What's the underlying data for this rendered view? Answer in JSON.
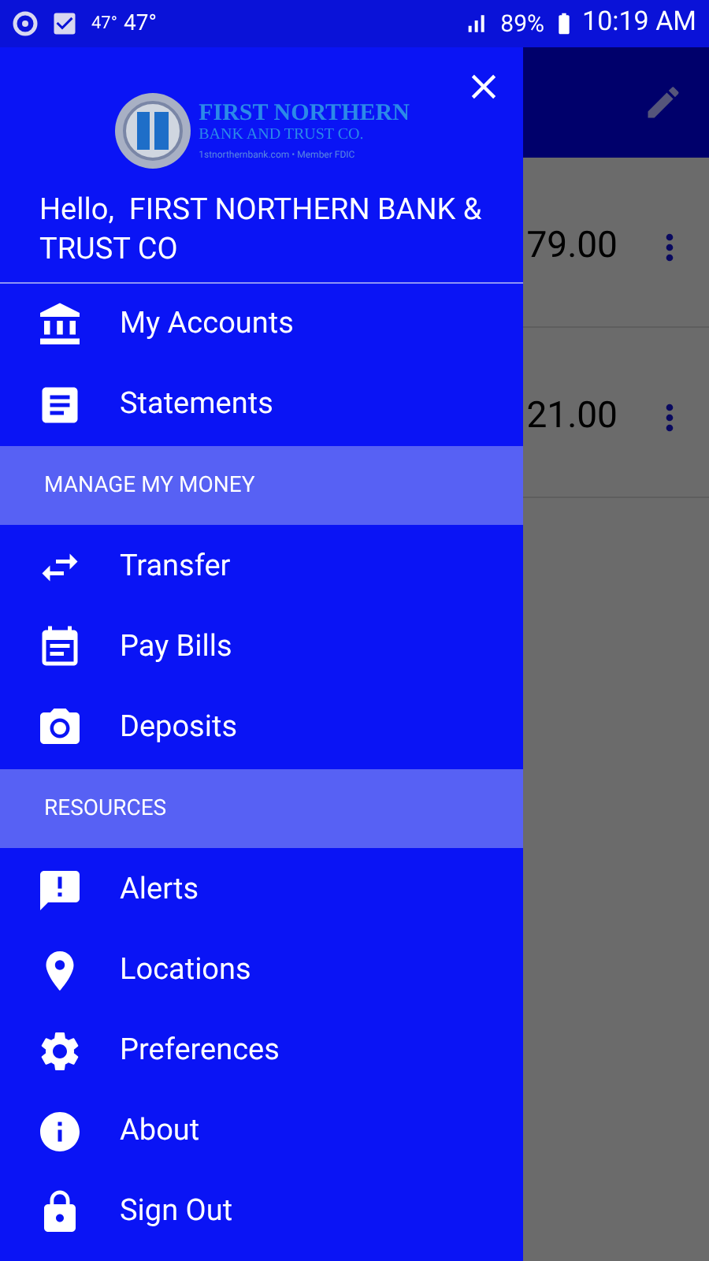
{
  "status_bar": {
    "temp_small": "47°",
    "temp": "47°",
    "battery": "89%",
    "time": "10:19 AM"
  },
  "background": {
    "rows": [
      {
        "amount": "79.00"
      },
      {
        "amount": "21.00"
      }
    ]
  },
  "drawer": {
    "logo": {
      "name": "FIRST NORTHERN",
      "subtitle": "BANK AND TRUST CO.",
      "tagline": "1stnorthernbank.com • Member FDIC"
    },
    "greeting": "Hello,  FIRST NORTHERN BANK & TRUST CO",
    "menu": [
      {
        "kind": "item",
        "label": "My Accounts"
      },
      {
        "kind": "item",
        "label": "Statements"
      },
      {
        "kind": "header",
        "label": "MANAGE MY MONEY"
      },
      {
        "kind": "item",
        "label": "Transfer"
      },
      {
        "kind": "item",
        "label": "Pay Bills"
      },
      {
        "kind": "item",
        "label": "Deposits"
      },
      {
        "kind": "header",
        "label": "RESOURCES"
      },
      {
        "kind": "item",
        "label": "Alerts"
      },
      {
        "kind": "item",
        "label": "Locations"
      },
      {
        "kind": "item",
        "label": "Preferences"
      },
      {
        "kind": "item",
        "label": "About"
      },
      {
        "kind": "item",
        "label": "Sign Out"
      }
    ]
  }
}
